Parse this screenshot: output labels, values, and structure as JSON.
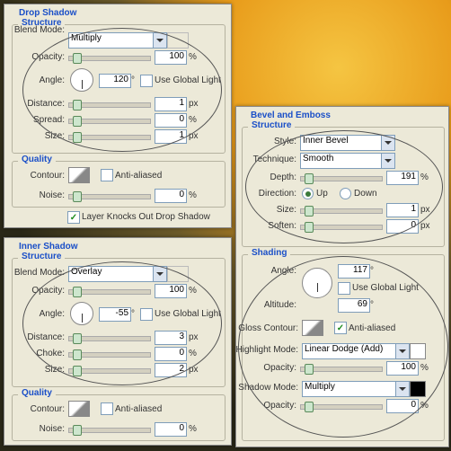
{
  "dropShadow": {
    "title": "Drop Shadow",
    "structure": "Structure",
    "blendMode": "Blend Mode:",
    "blendModeValue": "Multiply",
    "opacity": "Opacity:",
    "opacityValue": "100",
    "pct": "%",
    "angle": "Angle:",
    "angleValue": "120",
    "deg": "°",
    "useGlobal": "Use Global Light",
    "distance": "Distance:",
    "distanceValue": "1",
    "px": "px",
    "spread": "Spread:",
    "spreadValue": "0",
    "size": "Size:",
    "sizeValue": "1",
    "quality": "Quality",
    "contour": "Contour:",
    "antiAliased": "Anti-aliased",
    "noise": "Noise:",
    "noiseValue": "0",
    "knockOut": "Layer Knocks Out Drop Shadow"
  },
  "innerShadow": {
    "title": "Inner Shadow",
    "structure": "Structure",
    "blendMode": "Blend Mode:",
    "blendModeValue": "Overlay",
    "opacity": "Opacity:",
    "opacityValue": "100",
    "angle": "Angle:",
    "angleValue": "-55",
    "useGlobal": "Use Global Light",
    "distance": "Distance:",
    "distanceValue": "3",
    "choke": "Choke:",
    "chokeValue": "0",
    "size": "Size:",
    "sizeValue": "2",
    "quality": "Quality",
    "contour": "Contour:",
    "antiAliased": "Anti-aliased",
    "noise": "Noise:",
    "noiseValue": "0"
  },
  "bevel": {
    "title": "Bevel and Emboss",
    "structure": "Structure",
    "style": "Style:",
    "styleValue": "Inner Bevel",
    "technique": "Technique:",
    "techniqueValue": "Smooth",
    "depth": "Depth:",
    "depthValue": "191",
    "direction": "Direction:",
    "up": "Up",
    "down": "Down",
    "size": "Size:",
    "sizeValue": "1",
    "soften": "Soften:",
    "softenValue": "0",
    "shading": "Shading",
    "angle": "Angle:",
    "angleValue": "117",
    "useGlobal": "Use Global Light",
    "altitude": "Altitude:",
    "altitudeValue": "69",
    "glossContour": "Gloss Contour:",
    "antiAliased": "Anti-aliased",
    "highlightMode": "Highlight Mode:",
    "highlightValue": "Linear Dodge (Add)",
    "opacity": "Opacity:",
    "hOpacityValue": "100",
    "shadowMode": "Shadow Mode:",
    "shadowValue": "Multiply",
    "sOpacityValue": "0",
    "px": "px",
    "pct": "%",
    "deg": "°"
  }
}
